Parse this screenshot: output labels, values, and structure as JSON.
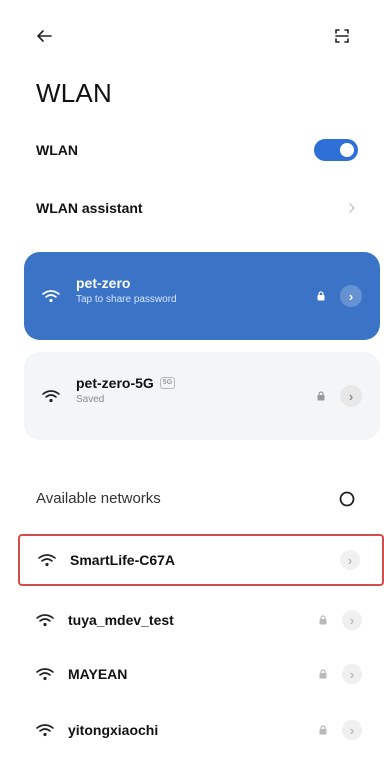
{
  "header": {
    "back_icon": "arrow-left-icon",
    "scan_icon": "scan-frame-icon",
    "title": "WLAN"
  },
  "settings": {
    "wlan_label": "WLAN",
    "wlan_enabled": true,
    "assistant_label": "WLAN assistant"
  },
  "networks": {
    "connected": {
      "name": "pet-zero",
      "subtitle": "Tap to share password",
      "secured": true
    },
    "saved": {
      "name": "pet-zero-5G",
      "band_badge": "5G",
      "subtitle": "Saved",
      "secured": true
    }
  },
  "available": {
    "header": "Available networks",
    "items": [
      {
        "name": "SmartLife-C67A",
        "secured": false,
        "selected": true
      },
      {
        "name": "tuya_mdev_test",
        "secured": true,
        "selected": false
      },
      {
        "name": "MAYEAN",
        "secured": true,
        "selected": false
      },
      {
        "name": "yitongxiaochi",
        "secured": true,
        "selected": false
      }
    ]
  },
  "colors": {
    "accent": "#2f6fd8",
    "connected_card": "#3b74c6",
    "selection_outline": "#d44d4d"
  }
}
